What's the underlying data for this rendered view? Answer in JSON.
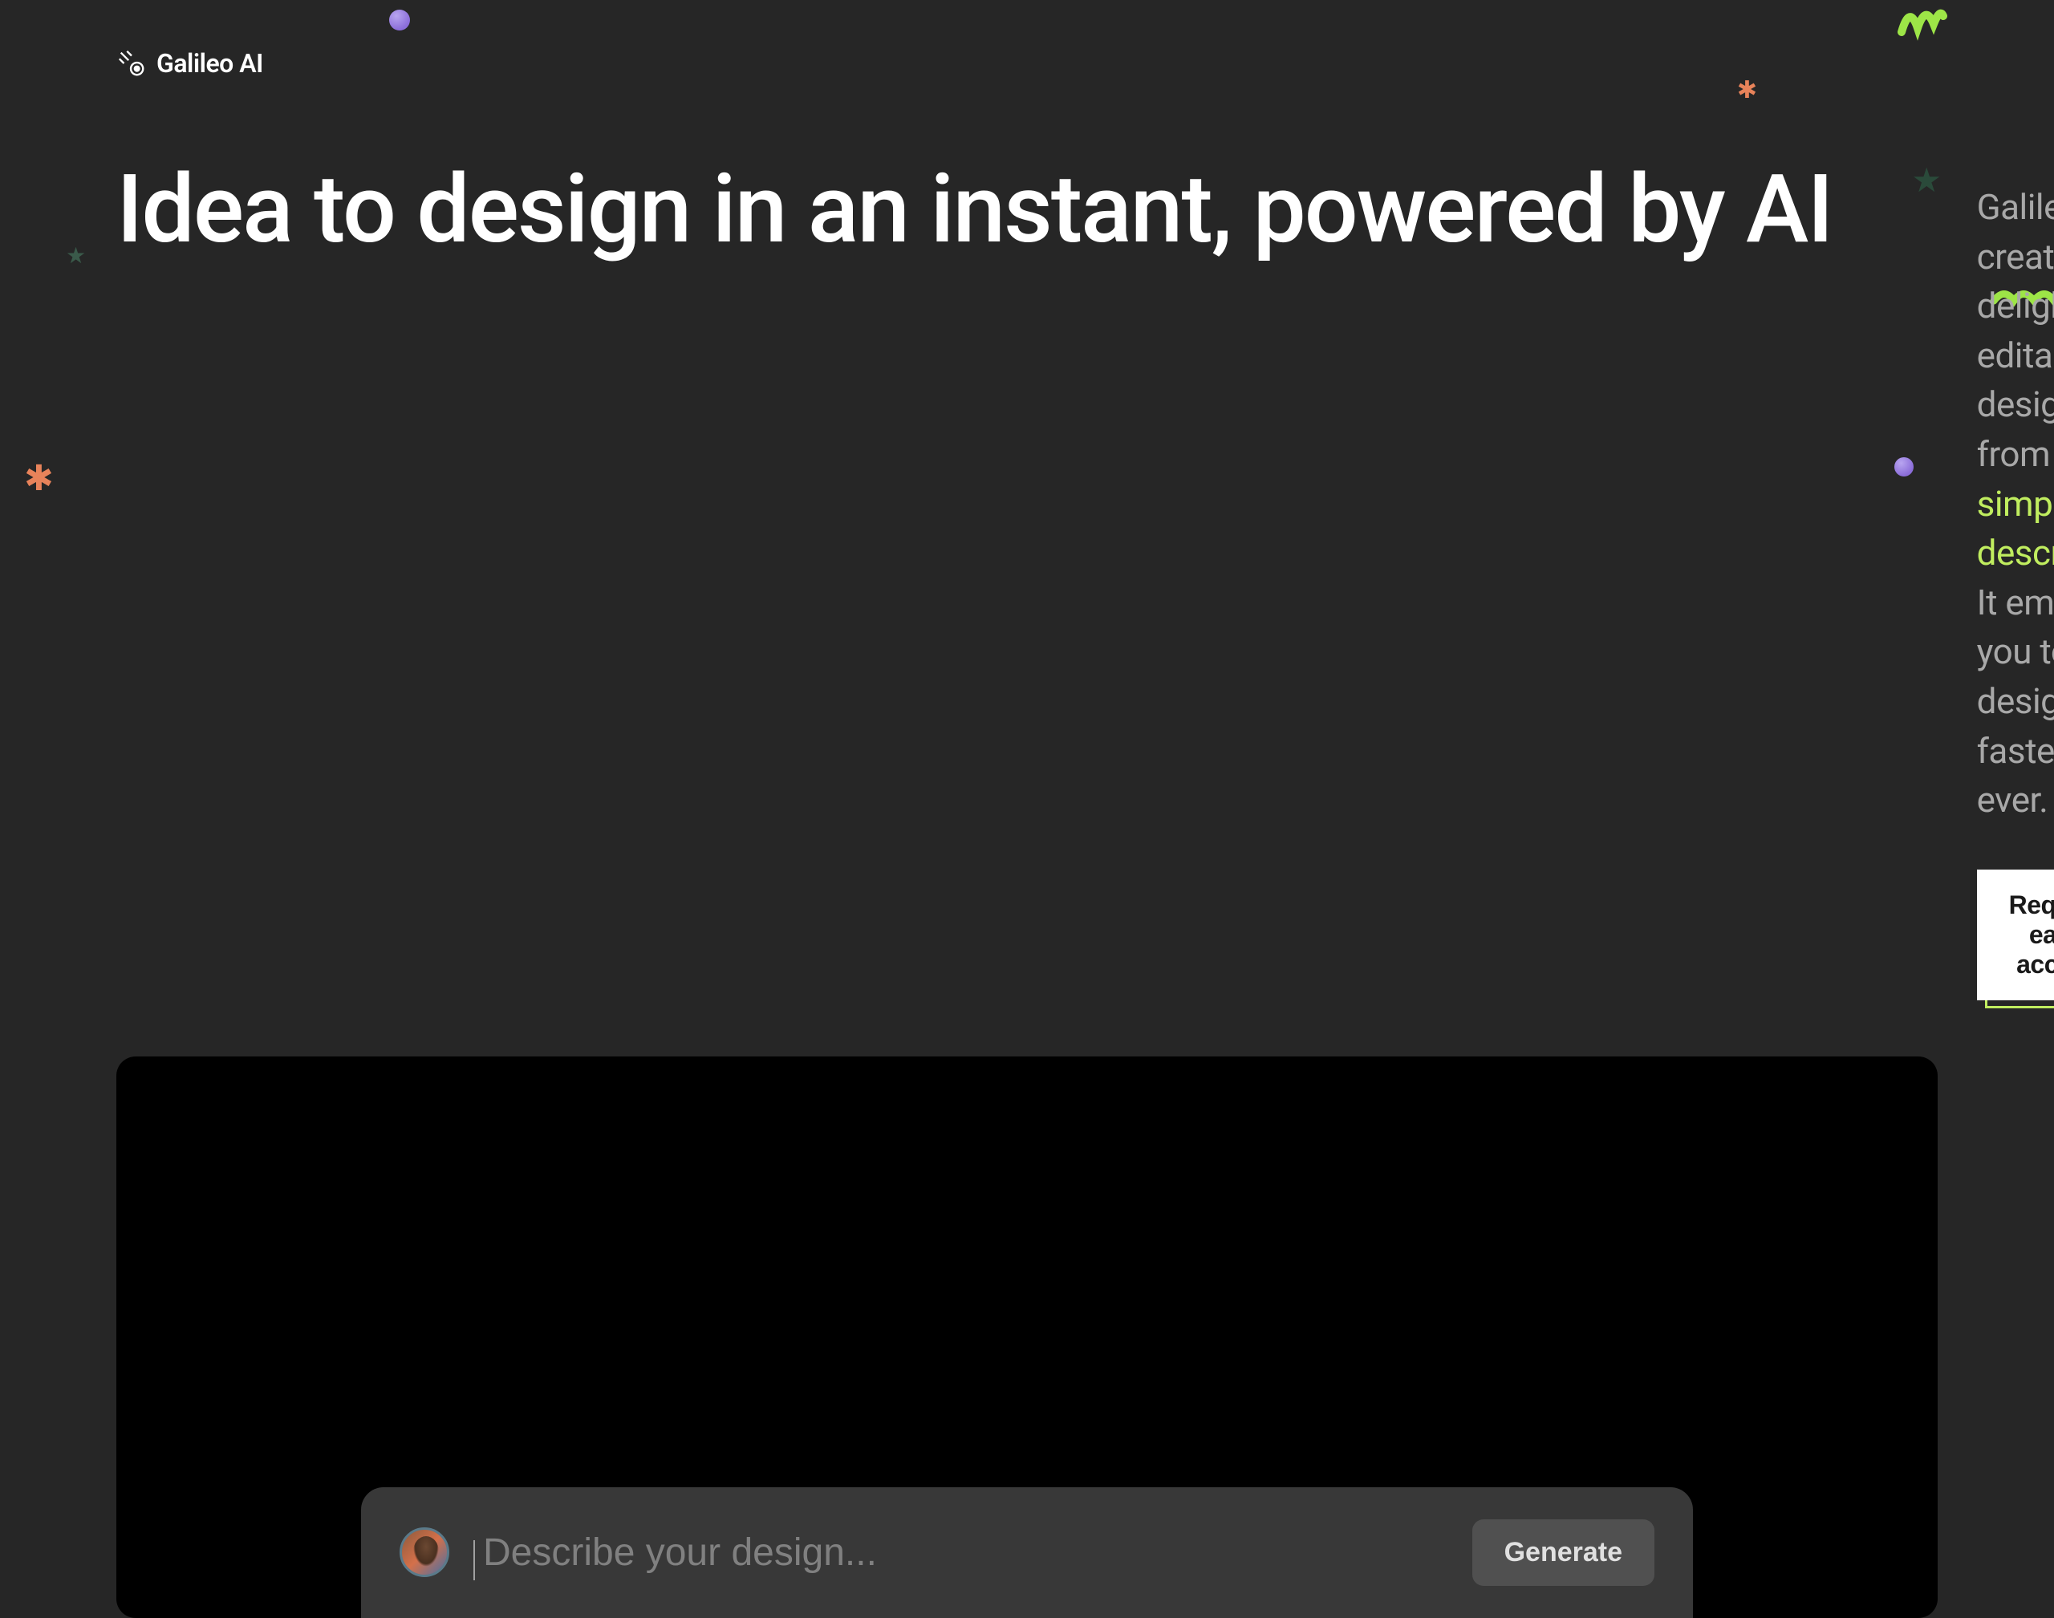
{
  "brand": {
    "name": "Galileo AI"
  },
  "hero": {
    "headline": "Idea to design in an instant, powered by AI",
    "description_pre": "Galileo AI creates delightful, editable UI designs from ",
    "description_highlight": "a simple text description",
    "description_post": ". It empowers you to design faster than ever."
  },
  "cta": {
    "label": "Request early access"
  },
  "prompt": {
    "placeholder": "Describe your design...",
    "generate_label": "Generate"
  },
  "colors": {
    "accent_green": "#c0ed5f",
    "bg_dark": "#262626",
    "bg_black": "#000000"
  }
}
